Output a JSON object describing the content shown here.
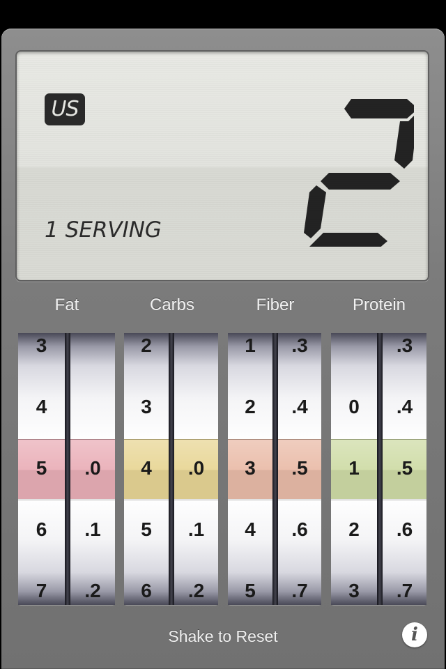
{
  "display": {
    "unit": "US",
    "serving": "1 SERVING",
    "points_value": "2"
  },
  "columns": [
    {
      "label": "Fat",
      "color": "#e6a1ac",
      "left_values": [
        "3",
        "4",
        "5",
        "6",
        "7"
      ],
      "right_values": [
        "",
        "",
        ".0",
        ".1",
        ".2"
      ],
      "selected": "5.0"
    },
    {
      "label": "Carbs",
      "color": "#e4cf84",
      "left_values": [
        "2",
        "3",
        "4",
        "5",
        "6"
      ],
      "right_values": [
        "",
        "",
        ".0",
        ".1",
        ".2"
      ],
      "selected": "4.0"
    },
    {
      "label": "Fiber",
      "color": "#e6b09a",
      "left_values": [
        "1",
        "2",
        "3",
        "4",
        "5"
      ],
      "right_values": [
        ".3",
        ".4",
        ".5",
        ".6",
        ".7"
      ],
      "selected": "3.5"
    },
    {
      "label": "Protein",
      "color": "#c7d698",
      "left_values": [
        "",
        "0",
        "1",
        "2",
        "3"
      ],
      "right_values": [
        ".3",
        ".4",
        ".5",
        ".6",
        ".7"
      ],
      "selected": "1.5"
    }
  ],
  "footer": {
    "hint": "Shake to Reset",
    "info_icon": "info-icon"
  }
}
